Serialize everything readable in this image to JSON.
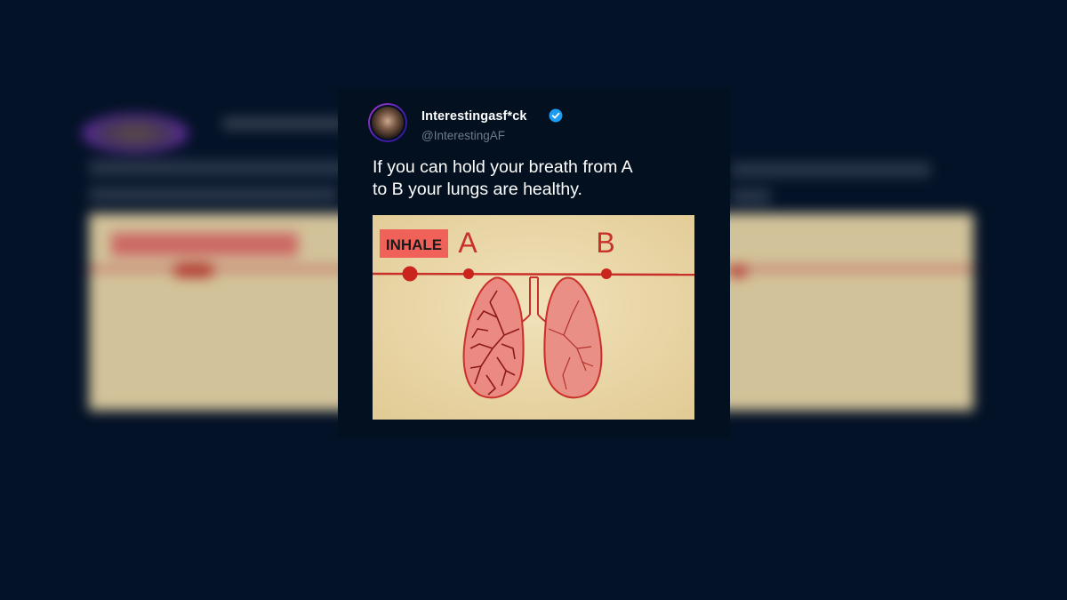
{
  "tweet": {
    "display_name": "Interestingasf*ck",
    "handle": "@InterestingAF",
    "text_line1": "If you can hold your breath from A",
    "text_line2": "to B your lungs are healthy.",
    "verified_icon": "verified-badge-icon"
  },
  "media": {
    "inhale_label": "INHALE",
    "point_a": "A",
    "point_b": "B",
    "illustration": "lungs-illustration"
  },
  "colors": {
    "background": "#041227",
    "card": "#02101f",
    "verified": "#1d9bf0",
    "media_bg": "#ecdcb0",
    "accent_red": "#d1322c",
    "inhale_box": "#f0615a"
  }
}
